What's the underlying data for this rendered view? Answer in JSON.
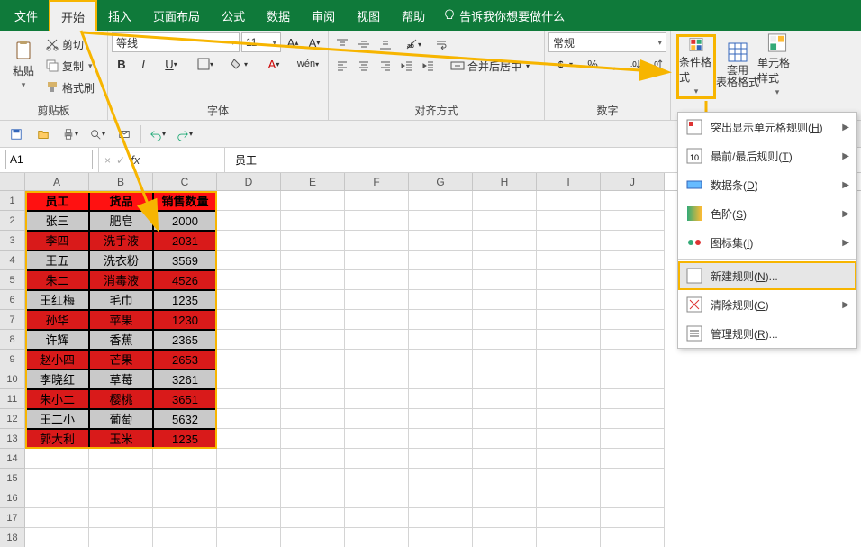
{
  "menubar": {
    "tabs": [
      "文件",
      "开始",
      "插入",
      "页面布局",
      "公式",
      "数据",
      "审阅",
      "视图",
      "帮助"
    ],
    "active_index": 1,
    "tell_me": "告诉我你想要做什么"
  },
  "ribbon": {
    "clipboard": {
      "paste": "粘贴",
      "cut": "剪切",
      "copy": "复制",
      "format_painter": "格式刷",
      "label": "剪贴板"
    },
    "font": {
      "name": "等线",
      "size": "11",
      "label": "字体"
    },
    "alignment": {
      "merge_center": "合并后居中",
      "label": "对齐方式"
    },
    "number": {
      "format": "常规",
      "label": "数字"
    },
    "styles": {
      "cond_fmt": "条件格式",
      "table_fmt": "套用\n表格格式",
      "cell_style": "单元格样式"
    }
  },
  "namebox": {
    "value": "A1"
  },
  "formula_bar": {
    "value": "员工"
  },
  "columns": [
    "A",
    "B",
    "C",
    "D",
    "E",
    "F",
    "G",
    "H",
    "I",
    "J"
  ],
  "row_count": 13,
  "table": {
    "headers": [
      "员工",
      "货品",
      "销售数量"
    ],
    "rows": [
      {
        "c": [
          "张三",
          "肥皂",
          "2000"
        ],
        "hl": false
      },
      {
        "c": [
          "李四",
          "洗手液",
          "2031"
        ],
        "hl": true
      },
      {
        "c": [
          "王五",
          "洗衣粉",
          "3569"
        ],
        "hl": false
      },
      {
        "c": [
          "朱二",
          "消毒液",
          "4526"
        ],
        "hl": true
      },
      {
        "c": [
          "王红梅",
          "毛巾",
          "1235"
        ],
        "hl": false
      },
      {
        "c": [
          "孙华",
          "苹果",
          "1230"
        ],
        "hl": true
      },
      {
        "c": [
          "许辉",
          "香蕉",
          "2365"
        ],
        "hl": false
      },
      {
        "c": [
          "赵小四",
          "芒果",
          "2653"
        ],
        "hl": true
      },
      {
        "c": [
          "李晓红",
          "草莓",
          "3261"
        ],
        "hl": false
      },
      {
        "c": [
          "朱小二",
          "樱桃",
          "3651"
        ],
        "hl": true
      },
      {
        "c": [
          "王二小",
          "葡萄",
          "5632"
        ],
        "hl": false
      },
      {
        "c": [
          "郭大利",
          "玉米",
          "1235"
        ],
        "hl": true
      }
    ]
  },
  "cf_menu": {
    "items": [
      {
        "label": "突出显示单元格规则",
        "hotkey": "H",
        "sub": true
      },
      {
        "label": "最前/最后规则",
        "hotkey": "T",
        "sub": true
      },
      {
        "label": "数据条",
        "hotkey": "D",
        "sub": true
      },
      {
        "label": "色阶",
        "hotkey": "S",
        "sub": true
      },
      {
        "label": "图标集",
        "hotkey": "I",
        "sub": true
      },
      {
        "label": "新建规则",
        "hotkey": "N",
        "ellipsis": true,
        "highlight": true
      },
      {
        "label": "清除规则",
        "hotkey": "C",
        "sub": true
      },
      {
        "label": "管理规则",
        "hotkey": "R",
        "ellipsis": true
      }
    ]
  },
  "chart_data": {
    "type": "table",
    "title": "",
    "columns": [
      "员工",
      "货品",
      "销售数量"
    ],
    "rows": [
      [
        "张三",
        "肥皂",
        2000
      ],
      [
        "李四",
        "洗手液",
        2031
      ],
      [
        "王五",
        "洗衣粉",
        3569
      ],
      [
        "朱二",
        "消毒液",
        4526
      ],
      [
        "王红梅",
        "毛巾",
        1235
      ],
      [
        "孙华",
        "苹果",
        1230
      ],
      [
        "许辉",
        "香蕉",
        2365
      ],
      [
        "赵小四",
        "芒果",
        2653
      ],
      [
        "李晓红",
        "草莓",
        3261
      ],
      [
        "朱小二",
        "樱桃",
        3651
      ],
      [
        "王二小",
        "葡萄",
        5632
      ],
      [
        "郭大利",
        "玉米",
        1235
      ]
    ]
  }
}
